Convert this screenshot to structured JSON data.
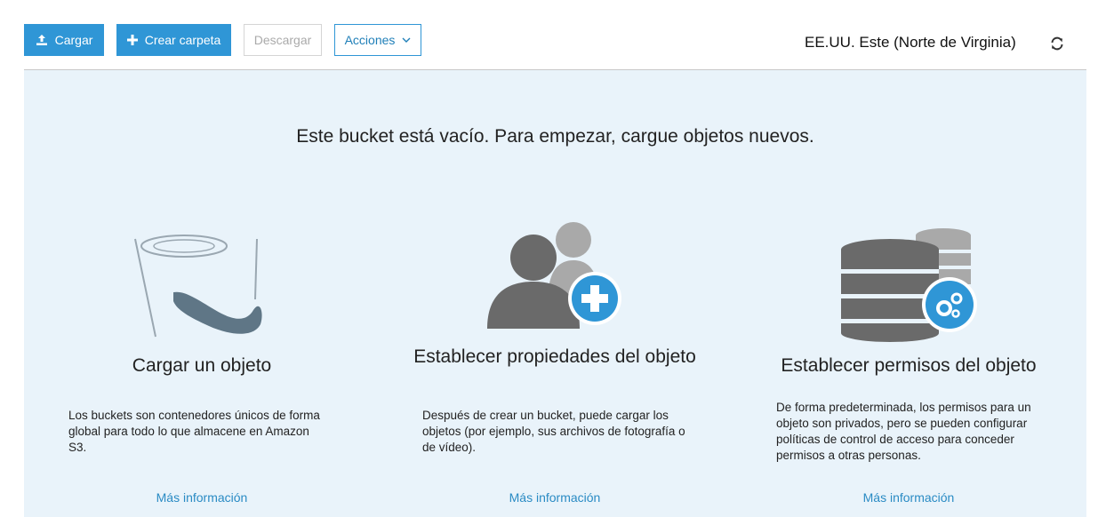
{
  "toolbar": {
    "upload_label": "Cargar",
    "create_folder_label": "Crear carpeta",
    "download_label": "Descargar",
    "actions_label": "Acciones"
  },
  "region": "EE.UU. Este (Norte de Virginia)",
  "empty": {
    "message": "Este bucket está vacío. Para empezar, cargue objetos nuevos."
  },
  "features": [
    {
      "icon": "bucket-icon",
      "title": "Cargar un objeto",
      "description": "Los buckets son contenedores únicos de forma global para todo lo que almacene en Amazon S3.",
      "link": "Más información"
    },
    {
      "icon": "users-add-icon",
      "title": "Establecer propiedades del objeto",
      "description": "Después de crear un bucket, puede cargar los objetos (por ejemplo, sus archivos de fotografía o de vídeo).",
      "link": "Más información"
    },
    {
      "icon": "database-settings-icon",
      "title": "Establecer permisos del objeto",
      "description": "De forma predeterminada, los permisos para un objeto son privados, pero se pueden configurar políticas de control de acceso para conceder permisos a otras personas.",
      "link": "Más información"
    }
  ],
  "colors": {
    "primary": "#2f96d6",
    "panel": "#e9f3fa",
    "link": "#2a8bc4"
  }
}
